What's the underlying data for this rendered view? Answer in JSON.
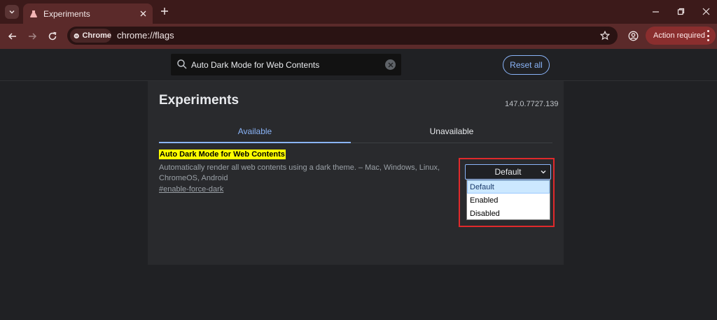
{
  "browser": {
    "tab": {
      "title": "Experiments"
    },
    "omnibox": {
      "chip_label": "Chrome",
      "url": "chrome://flags"
    },
    "action_required_label": "Action required",
    "theme_color": "#5b2a2a"
  },
  "flags_page": {
    "search": {
      "value": "Auto Dark Mode for Web Contents"
    },
    "reset_all_label": "Reset all",
    "title": "Experiments",
    "version": "147.0.7727.139",
    "tabs": [
      {
        "label": "Available",
        "active": true
      },
      {
        "label": "Unavailable",
        "active": false
      }
    ],
    "flag": {
      "title": "Auto Dark Mode for Web Contents",
      "description": "Automatically render all web contents using a dark theme. – Mac, Windows, Linux, ChromeOS, Android",
      "link": "#enable-force-dark",
      "select": {
        "selected": "Default",
        "options": [
          "Default",
          "Enabled",
          "Disabled"
        ],
        "highlighted_option": "Default"
      }
    },
    "accent_color": "#8ab4f8",
    "highlight_color": "#ffff00",
    "annotation_color": "#e0292b"
  }
}
